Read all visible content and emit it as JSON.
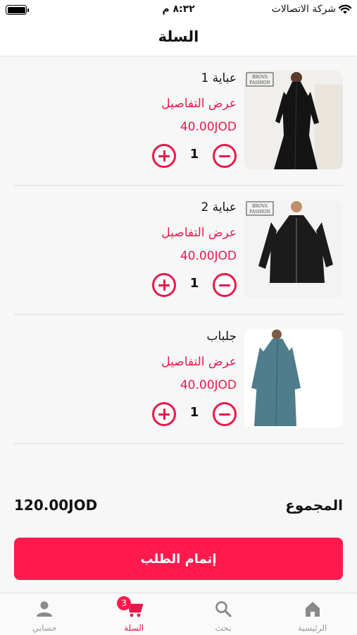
{
  "status_bar": {
    "carrier": "شركة الاتصالات",
    "time": "٨:٣٢ م"
  },
  "header": {
    "title": "السلة"
  },
  "cart": {
    "items": [
      {
        "name": "عباية 1",
        "details_label": "عرض التفاصيل",
        "price": "40.00JOD",
        "quantity": "1",
        "image_text": [
          "BROVA",
          "FASHION"
        ],
        "garment_color": "#141414"
      },
      {
        "name": "عباية 2",
        "details_label": "عرض التفاصيل",
        "price": "40.00JOD",
        "quantity": "1",
        "image_text": [
          "BROVA",
          "FASHION"
        ],
        "garment_color": "#1b1b1b"
      },
      {
        "name": "جلباب",
        "details_label": "عرض التفاصيل",
        "price": "40.00JOD",
        "quantity": "1",
        "garment_color": "#4f7d8c"
      }
    ]
  },
  "summary": {
    "total_label": "المجموع",
    "total_value": "120.00JOD"
  },
  "checkout": {
    "label": "إتمام الطلب"
  },
  "tab_bar": {
    "tabs": [
      {
        "label": "حسابي",
        "icon": "person-icon",
        "active": false
      },
      {
        "label": "السلة",
        "icon": "cart-icon",
        "active": true,
        "badge": "3"
      },
      {
        "label": "بحث",
        "icon": "search-icon",
        "active": false
      },
      {
        "label": "الرئيسية",
        "icon": "home-icon",
        "active": false
      }
    ]
  },
  "colors": {
    "accent": "#e8194a",
    "button": "#ff1a4d",
    "tab_inactive": "#9a9a9a"
  }
}
